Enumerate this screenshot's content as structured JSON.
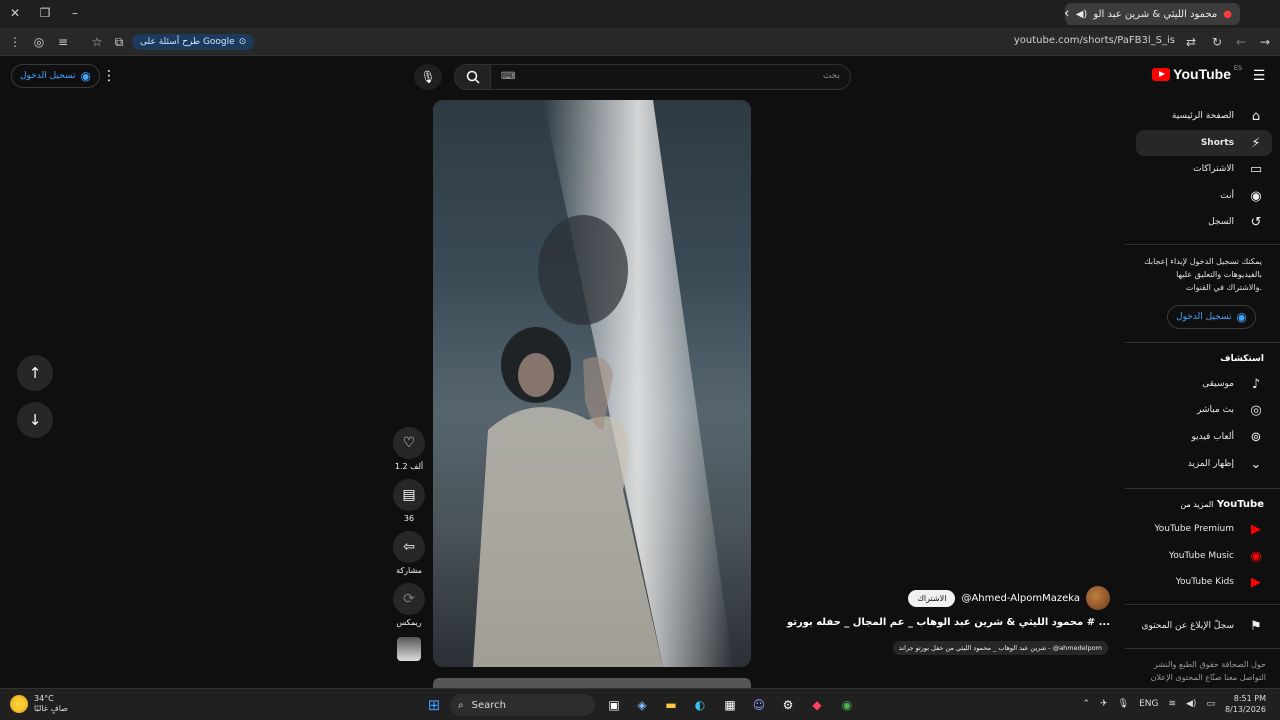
{
  "browser": {
    "tab_title": "محمود الليثي & شرين عبد الو",
    "new_tab_icon": "plus-icon",
    "url": "youtube.com/shorts/PaFB3l_S_is",
    "ask_google_label": "طرح أسئلة على Google"
  },
  "youtube": {
    "logo_text": "YouTube",
    "logo_country": "ES",
    "search_placeholder": "بحث",
    "sign_in_label": "تسجيل الدخول"
  },
  "sidebar": {
    "items": [
      {
        "label": "الصفحة الرئيسية",
        "icon": "home-icon"
      },
      {
        "label": "Shorts",
        "icon": "shorts-icon",
        "active": true
      },
      {
        "label": "الاشتراكات",
        "icon": "subscriptions-icon"
      },
      {
        "label": "أنت",
        "icon": "you-icon"
      },
      {
        "label": "السجل",
        "icon": "history-icon"
      }
    ],
    "signin_prompt": "يمكنك تسجيل الدخول لإبداء إعجابك بالفيديوهات والتعليق عليها والاشتراك في القنوات.",
    "signin_button": "تسجيل الدخول",
    "explore_heading": "استكشاف",
    "explore_items": [
      {
        "label": "موسيقى",
        "icon": "music-icon"
      },
      {
        "label": "بث مباشر",
        "icon": "live-icon"
      },
      {
        "label": "ألعاب فيديو",
        "icon": "gaming-icon"
      },
      {
        "label": "إظهار المزيد",
        "icon": "chevron-down-icon"
      }
    ],
    "more_heading_prefix": "المزيد من",
    "more_heading_brand": "YouTube",
    "more_items": [
      {
        "label": "YouTube Premium"
      },
      {
        "label": "YouTube Music"
      },
      {
        "label": "YouTube Kids"
      }
    ],
    "report_label": "سجلّ الإبلاغ عن المحتوى",
    "footer_line1": "حول  الصحافة  حقوق الطبع والنشر",
    "footer_line2": "التواصل معنا  صنّاع المحتوى  الإعلان"
  },
  "short": {
    "likes": "1.2 ألف",
    "comments": "36",
    "share_label": "مشاركة",
    "remix_label": "ريمكس",
    "channel": "@Ahmed-AlpomMazeka",
    "subscribe_label": "الاشتراك",
    "title": "محمود الليثي & شرين عبد الوهاب _ عم المجال _ حفله بورتو # ...",
    "subtitle": "شرين عبد الوهاب _ محمود الليثي من حفل بورتو جراند - @ahmedelpom"
  },
  "taskbar": {
    "temp": "34°C",
    "weather_desc": "صافٍ غالبًا",
    "search_label": "Search",
    "lang": "ENG",
    "time": "8:51 PM",
    "date": "8/13/2026"
  }
}
